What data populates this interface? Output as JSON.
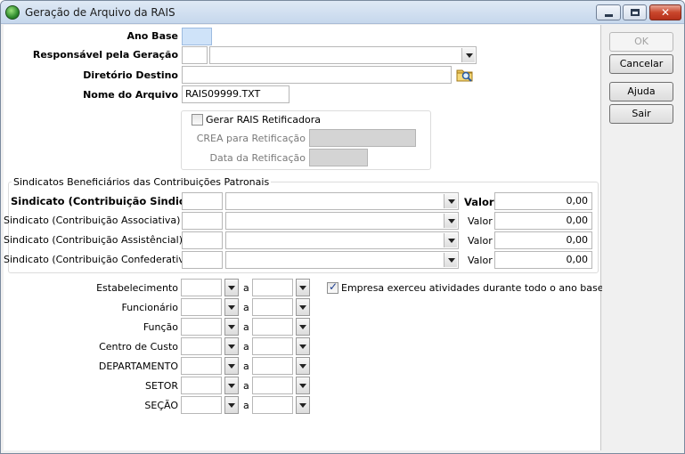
{
  "window": {
    "title": "Geração de Arquivo da RAIS",
    "close_glyph": "✕"
  },
  "form": {
    "ano_base": {
      "label": "Ano Base",
      "value": ""
    },
    "responsavel": {
      "label": "Responsável pela Geração",
      "code": "",
      "name": ""
    },
    "diretorio": {
      "label": "Diretório Destino",
      "value": ""
    },
    "nome_arquivo": {
      "label": "Nome do Arquivo",
      "value": "RAIS09999.TXT"
    },
    "retificadora": {
      "checkbox_label": "Gerar RAIS Retificadora",
      "checked": false,
      "crea_label": "CREA para Retificação",
      "crea_value": "",
      "data_label": "Data da Retificação",
      "data_value": ""
    }
  },
  "sindicatos": {
    "group_title": "Sindicatos Beneficiários das Contribuições Patronais",
    "rows": [
      {
        "label": "Sindicato (Contribuição Sindical)",
        "code": "",
        "name": "",
        "valor_label": "Valor",
        "valor": "0,00"
      },
      {
        "label": "Sindicato (Contribuição Associativa)",
        "code": "",
        "name": "",
        "valor_label": "Valor",
        "valor": "0,00"
      },
      {
        "label": "Sindicato (Contribuição Assistêncial)",
        "code": "",
        "name": "",
        "valor_label": "Valor",
        "valor": "0,00"
      },
      {
        "label": "Sindicato (Contribuição Confederativa)",
        "code": "",
        "name": "",
        "valor_label": "Valor",
        "valor": "0,00"
      }
    ]
  },
  "ranges": {
    "separator": "a",
    "rows": [
      {
        "label": "Estabelecimento"
      },
      {
        "label": "Funcionário"
      },
      {
        "label": "Função"
      },
      {
        "label": "Centro de Custo"
      },
      {
        "label": "DEPARTAMENTO"
      },
      {
        "label": "SETOR"
      },
      {
        "label": "SEÇÃO"
      }
    ],
    "empresa_checkbox": {
      "label": "Empresa exerceu atividades durante todo o ano base",
      "checked": true
    }
  },
  "buttons": {
    "ok": "OK",
    "cancelar": "Cancelar",
    "ajuda": "Ajuda",
    "sair": "Sair"
  },
  "icons": {
    "app": "app-globe-icon",
    "folder": "folder-search-icon",
    "dropdown": "chevron-down-icon"
  }
}
